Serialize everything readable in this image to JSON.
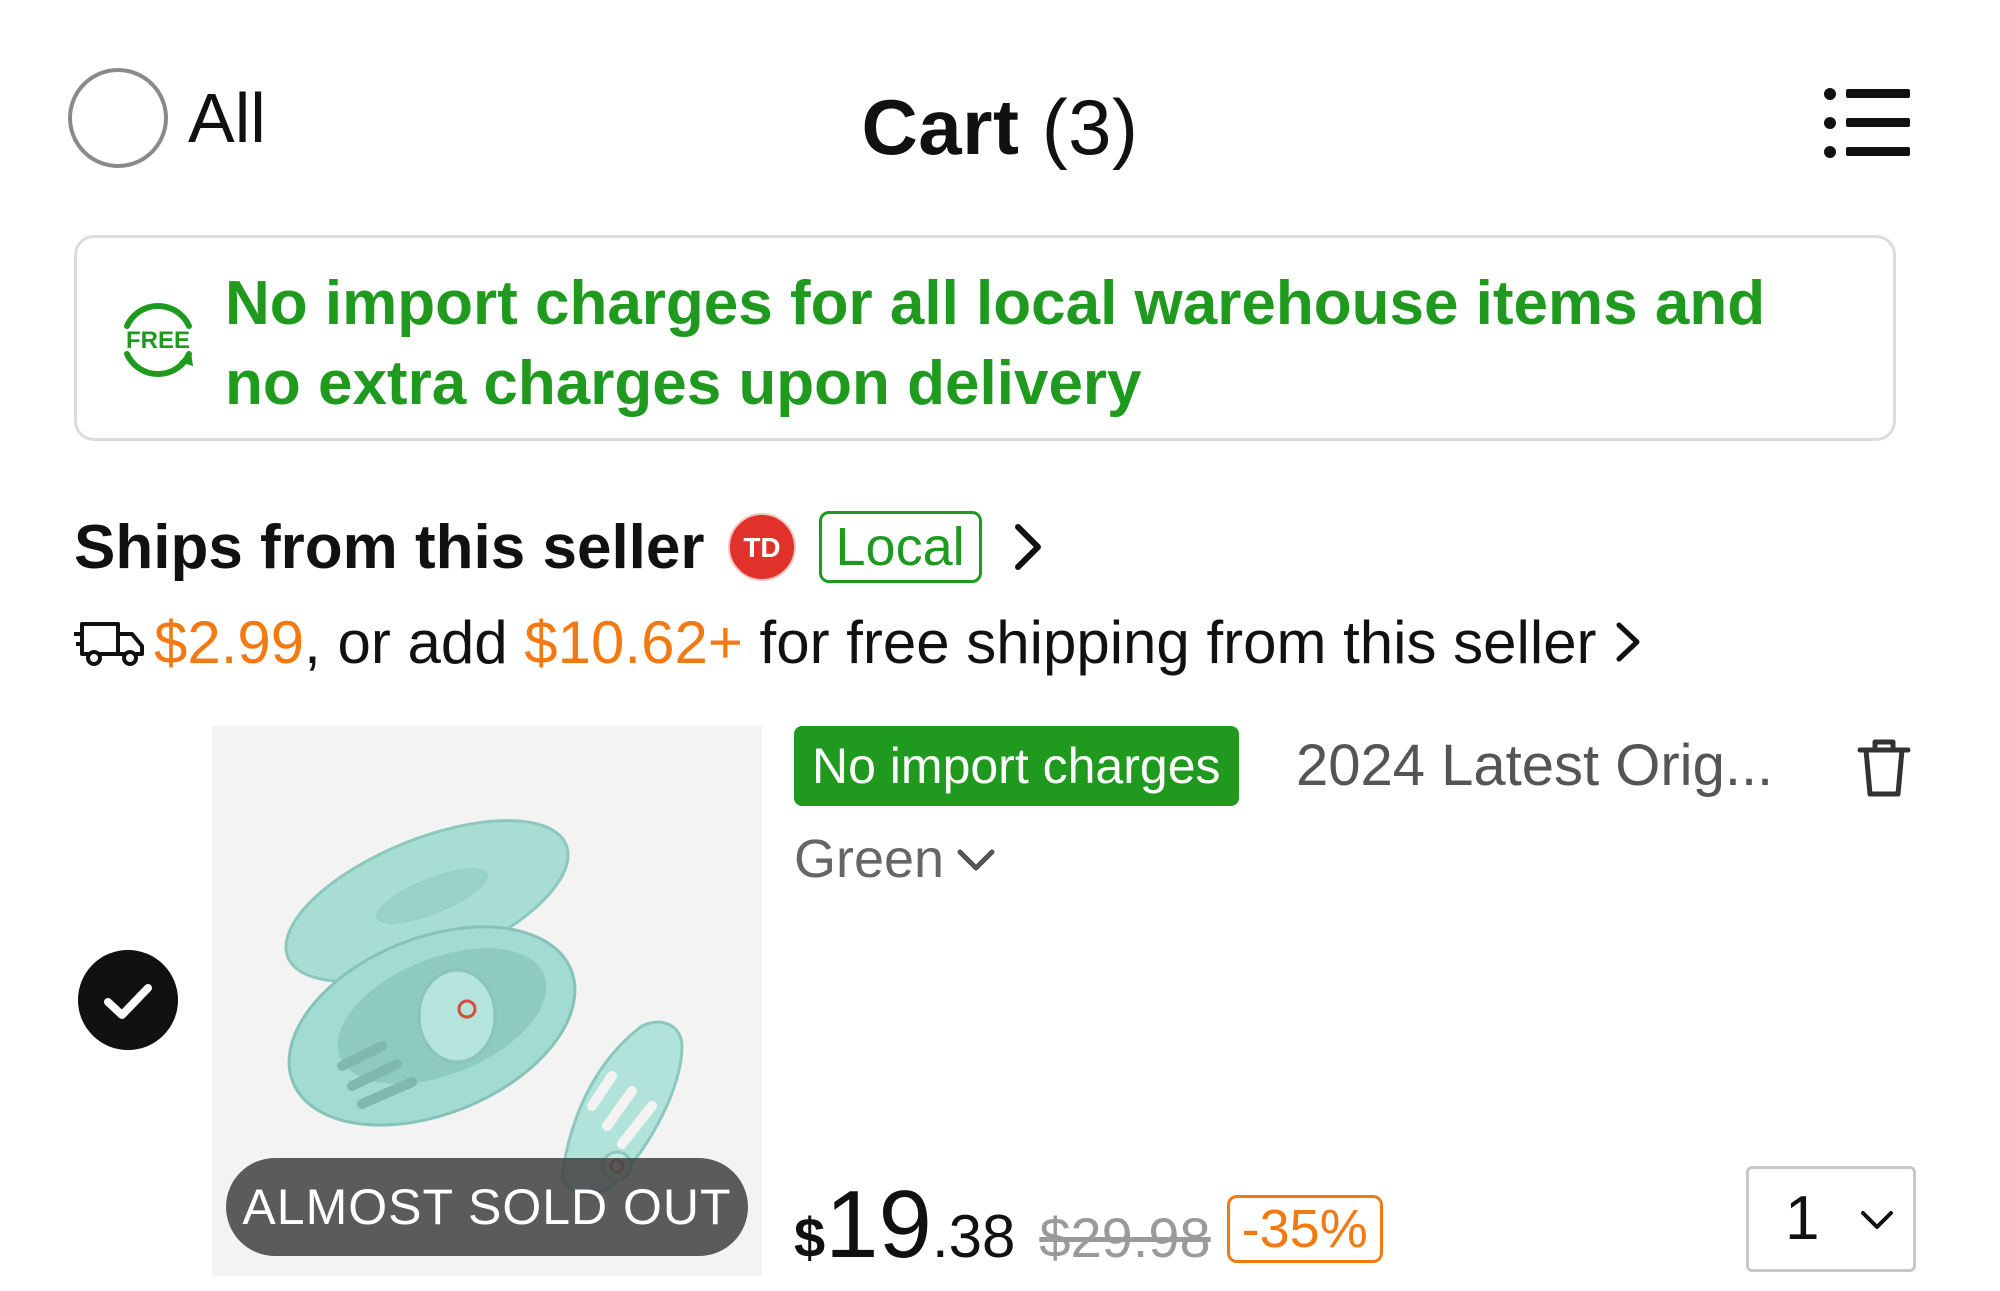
{
  "header": {
    "select_all_label": "All",
    "title": "Cart",
    "count": "(3)"
  },
  "banner": {
    "icon_text": "FREE",
    "line1": "No import charges for all local warehouse items and",
    "line2": "no extra charges upon delivery"
  },
  "seller": {
    "label": "Ships from this seller",
    "logo_text": "TD",
    "badge": "Local"
  },
  "shipping": {
    "cost": "$2.99",
    "text_mid": ", or add ",
    "add_amount": "$10.62+",
    "text_end": " for free shipping from this seller"
  },
  "item": {
    "checked": true,
    "badge_sold_out": "ALMOST SOLD OUT",
    "badge_import": "No import charges",
    "title": "2024 Latest Orig...",
    "variant": "Green",
    "price_currency": "$",
    "price_main": "19",
    "price_cents": ".38",
    "price_old": "$29.98",
    "discount": "-35%",
    "quantity": "1"
  },
  "colors": {
    "green": "#1f9a1f",
    "orange": "#f37a12",
    "brand_red": "#e0312a",
    "product_mint": "#9fd9cf"
  },
  "icons": [
    "menu-icon",
    "free-icon",
    "td-logo",
    "chevron-right-icon",
    "truck-icon",
    "trash-icon",
    "chevron-down-icon",
    "check-icon"
  ]
}
